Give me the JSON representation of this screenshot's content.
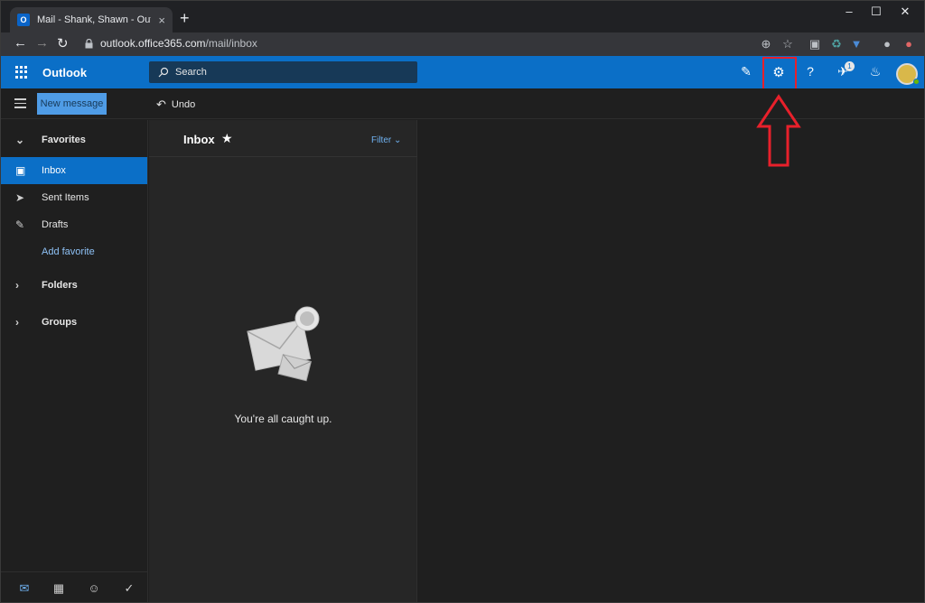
{
  "browser": {
    "tab_title": "Mail - Shank, Shawn - Outlook",
    "url_host": "outlook.office365.com",
    "url_path": "/mail/inbox",
    "new_tab": "+",
    "close_tab": "×"
  },
  "header": {
    "brand": "Outlook",
    "search_placeholder": "Search",
    "help": "?",
    "notification_badge": "1"
  },
  "commands": {
    "new_message": "New message",
    "undo": "Undo"
  },
  "sidebar": {
    "favorites": "Favorites",
    "items": [
      {
        "label": "Inbox"
      },
      {
        "label": "Sent Items"
      },
      {
        "label": "Drafts"
      },
      {
        "label": "Add favorite"
      }
    ],
    "folders": "Folders",
    "groups": "Groups"
  },
  "list": {
    "title": "Inbox",
    "filter": "Filter",
    "empty_message": "You're all caught up."
  },
  "colors": {
    "accent": "#0b6fc7",
    "highlight": "#e8202b"
  }
}
